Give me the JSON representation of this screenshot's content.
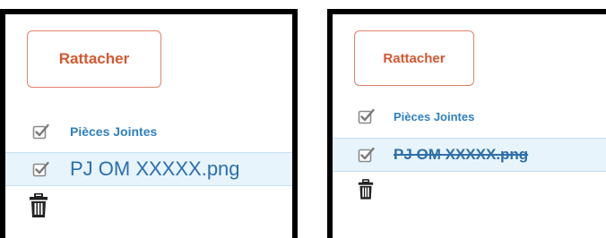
{
  "colors": {
    "accent_orange": "#d4572f",
    "link_blue": "#2f7fc0",
    "selected_row_bg": "#e8f4fc",
    "frame_border": "#000000"
  },
  "icons": {
    "checkbox": "checkbox-checked-icon",
    "trash": "trash-icon"
  },
  "panels": [
    {
      "attach_button_label": "Rattacher",
      "attachments_header": "Pièces Jointes",
      "file_name": "PJ OM XXXXX.png",
      "file_deleted": false
    },
    {
      "attach_button_label": "Rattacher",
      "attachments_header": "Pièces Jointes",
      "file_name": "PJ OM XXXXX.png",
      "file_deleted": true
    }
  ]
}
